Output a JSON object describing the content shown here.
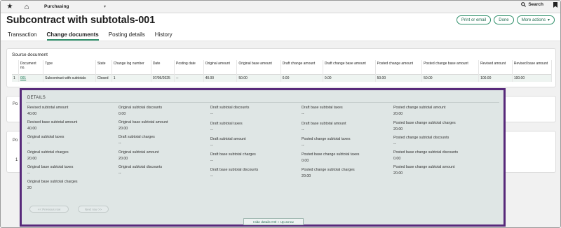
{
  "topbar": {
    "module": "Purchasing",
    "search_label": "Search"
  },
  "header": {
    "title": "Subcontract with subtotals-001",
    "actions": [
      "Print or email",
      "Done",
      "More actions"
    ]
  },
  "tabs": [
    "Transaction",
    "Change documents",
    "Posting details",
    "History"
  ],
  "source_document": {
    "title": "Source document",
    "columns": [
      "Document no.",
      "Type",
      "State",
      "Change log number",
      "Date",
      "Posting date",
      "Original amount",
      "Original base amount",
      "Draft change amount",
      "Draft change base amount",
      "Posted change amount",
      "Posted change base amount",
      "Revised amount",
      "Revised base amount"
    ],
    "row": {
      "index": "1",
      "cells": [
        "001",
        "Subcontract with subtotals",
        "Closed",
        "1",
        "07/05/2025",
        "--",
        "40.00",
        "50.00",
        "0.00",
        "0.00",
        "50.00",
        "50.00",
        "100.00",
        "100.00"
      ]
    }
  },
  "background": {
    "label_b": "Po",
    "label_c": "Po",
    "row_c_index": "1"
  },
  "details": {
    "title": "DETAILS",
    "columns": [
      [
        {
          "label": "Revised subtotal amount",
          "value": "40.00"
        },
        {
          "label": "Revised base subtotal amount",
          "value": "40.00"
        },
        {
          "label": "Original subtotal taxes",
          "value": "--"
        },
        {
          "label": "Original subtotal charges",
          "value": "20.00"
        },
        {
          "label": "Original base subtotal taxes",
          "value": "--"
        },
        {
          "label": "Original base subtotal charges",
          "value": "20"
        }
      ],
      [
        {
          "label": "Original subtotal discounts",
          "value": "0.00"
        },
        {
          "label": "Original base subtotal amount",
          "value": "20.00"
        },
        {
          "label": "Draft subtotal charges",
          "value": "--"
        },
        {
          "label": "Original subtotal amount",
          "value": "20.00"
        },
        {
          "label": "Original subtotal discounts",
          "value": "--"
        }
      ],
      [
        {
          "label": "Draft subtotal discounts",
          "value": "--"
        },
        {
          "label": "Draft subtotal taxes",
          "value": "--"
        },
        {
          "label": "Draft subtotal amount",
          "value": "--"
        },
        {
          "label": "Draft base subtotal charges",
          "value": "--"
        },
        {
          "label": "Draft base subtotal discounts",
          "value": "--"
        }
      ],
      [
        {
          "label": "Draft base subtotal taxes",
          "value": "--"
        },
        {
          "label": "Draft base subtotal amount",
          "value": "--"
        },
        {
          "label": "Posted change subtotal taxes",
          "value": "--"
        },
        {
          "label": "Posted base change subtotal taxes",
          "value": "0.00"
        },
        {
          "label": "Posted change subtotal charges",
          "value": "20.00"
        }
      ],
      [
        {
          "label": "Posted change subtotal amount",
          "value": "20.00"
        },
        {
          "label": "Posted base change subtotal charges",
          "value": "20.00"
        },
        {
          "label": "Posted change subtotal discounts",
          "value": "--"
        },
        {
          "label": "Posted base change subtotal discounts",
          "value": "0.00"
        },
        {
          "label": "Posted base change subtotal amount",
          "value": "20.00"
        }
      ]
    ],
    "prev_button": "<< Previous row",
    "next_button": "Next row >>",
    "hide_button": "Hide details Ctrl + Up arrow"
  }
}
